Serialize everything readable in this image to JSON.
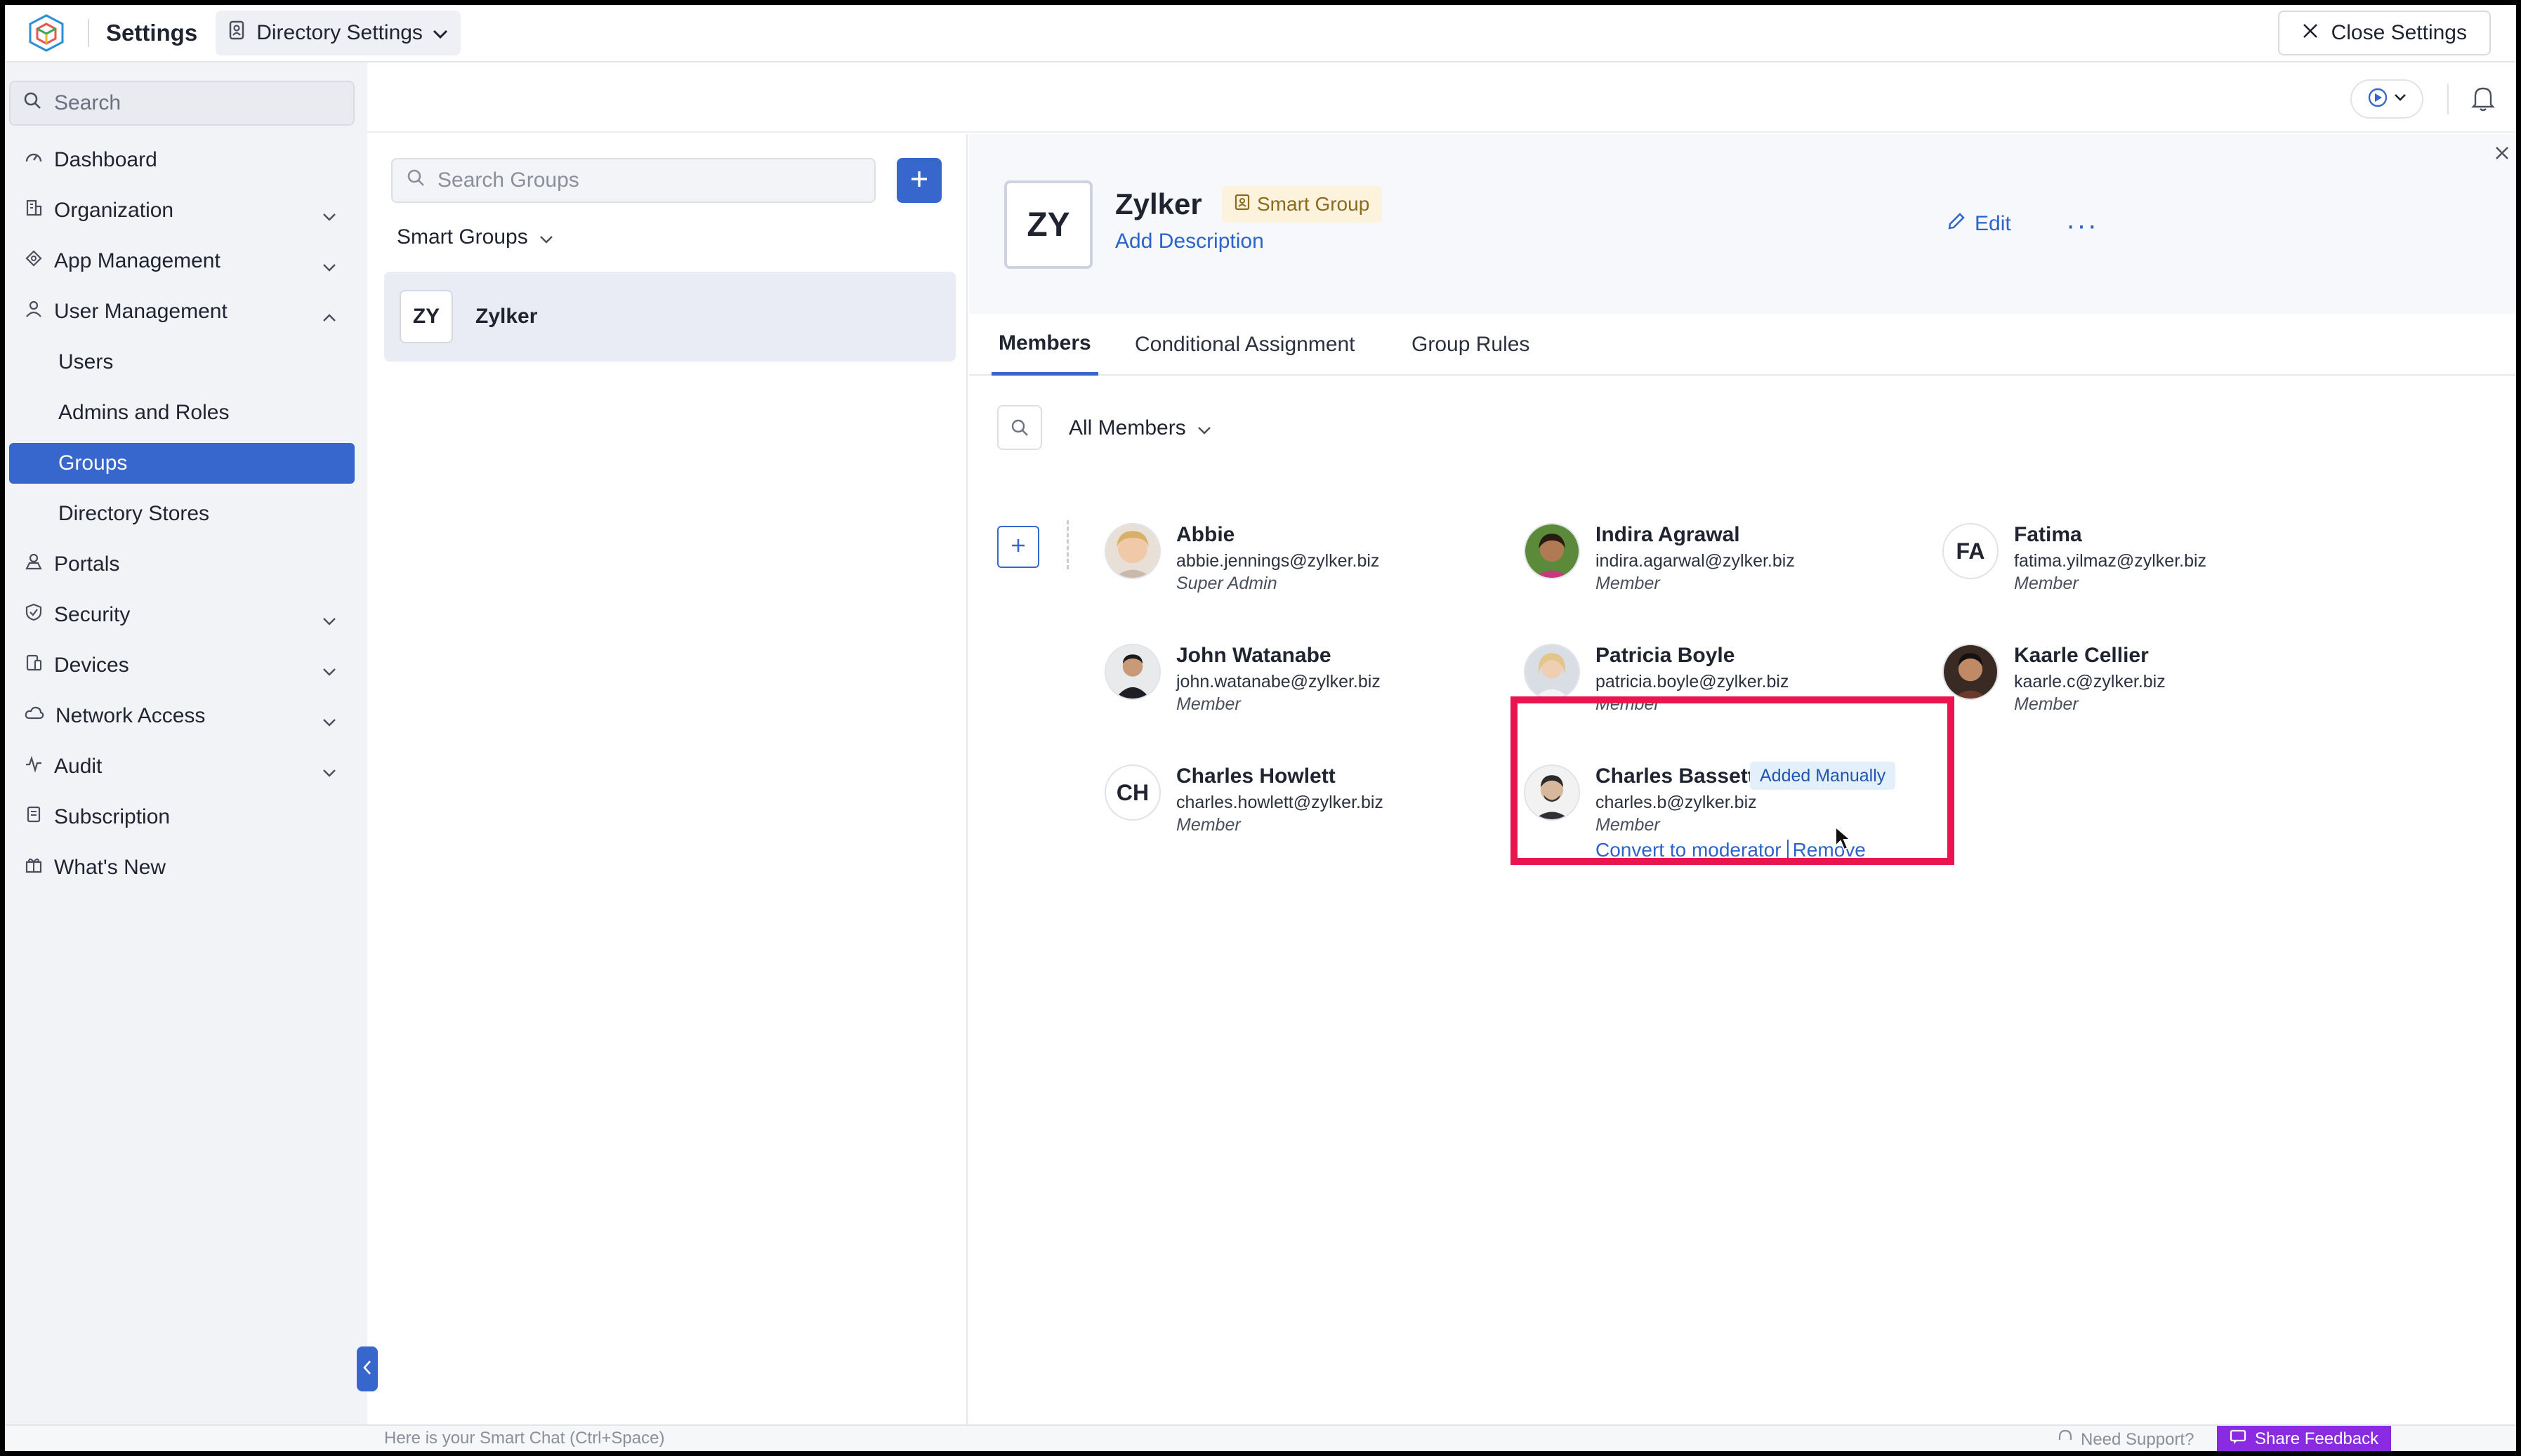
{
  "app": {
    "title": "Settings",
    "directory_button": "Directory Settings",
    "close_settings": "Close Settings"
  },
  "sidebar": {
    "search_placeholder": "Search",
    "items": [
      {
        "label": "Dashboard",
        "icon": "dashboard-icon"
      },
      {
        "label": "Organization",
        "icon": "building-icon"
      },
      {
        "label": "App Management",
        "icon": "apps-icon"
      },
      {
        "label": "User Management",
        "icon": "user-icon"
      },
      {
        "label": "Users"
      },
      {
        "label": "Admins and Roles"
      },
      {
        "label": "Groups"
      },
      {
        "label": "Directory Stores"
      },
      {
        "label": "Portals",
        "icon": "portal-icon"
      },
      {
        "label": "Security",
        "icon": "shield-icon"
      },
      {
        "label": "Devices",
        "icon": "device-icon"
      },
      {
        "label": "Network Access",
        "icon": "cloud-icon"
      },
      {
        "label": "Audit",
        "icon": "pulse-icon"
      },
      {
        "label": "Subscription",
        "icon": "document-icon"
      },
      {
        "label": "What's New",
        "icon": "gift-icon"
      }
    ]
  },
  "groups": {
    "search_placeholder": "Search Groups",
    "filter_label": "Smart Groups",
    "list": [
      {
        "initials": "ZY",
        "name": "Zylker"
      }
    ]
  },
  "detail": {
    "initials": "ZY",
    "name": "Zylker",
    "badge": "Smart Group",
    "add_description": "Add Description",
    "edit": "Edit",
    "more": "···",
    "tabs": [
      "Members",
      "Conditional Assignment",
      "Group Rules"
    ],
    "member_filter": "All Members",
    "members": [
      {
        "name": "Abbie",
        "email": "abbie.jennings@zylker.biz",
        "role": "Super Admin"
      },
      {
        "name": "Indira Agrawal",
        "email": "indira.agarwal@zylker.biz",
        "role": "Member"
      },
      {
        "name": "Fatima",
        "email": "fatima.yilmaz@zylker.biz",
        "role": "Member",
        "initials": "FA"
      },
      {
        "name": "John Watanabe",
        "email": "john.watanabe@zylker.biz",
        "role": "Member"
      },
      {
        "name": "Patricia Boyle",
        "email": "patricia.boyle@zylker.biz",
        "role": "Member"
      },
      {
        "name": "Kaarle Cellier",
        "email": "kaarle.c@zylker.biz",
        "role": "Member"
      },
      {
        "name": "Charles Howlett",
        "email": "charles.howlett@zylker.biz",
        "role": "Member",
        "initials": "CH"
      },
      {
        "name": "Charles Bassett",
        "email": "charles.b@zylker.biz",
        "role": "Member",
        "badge": "Added Manually",
        "actions": {
          "convert": "Convert to moderator",
          "remove": "Remove"
        }
      }
    ]
  },
  "footer": {
    "smart_chat": "Here is your Smart Chat (Ctrl+Space)",
    "need_support": "Need Support?",
    "share_feedback": "Share Feedback"
  },
  "colors": {
    "accent": "#3767cc",
    "link": "#2b63c9",
    "highlight": "#e8154f",
    "feedback": "#8a2be2"
  }
}
